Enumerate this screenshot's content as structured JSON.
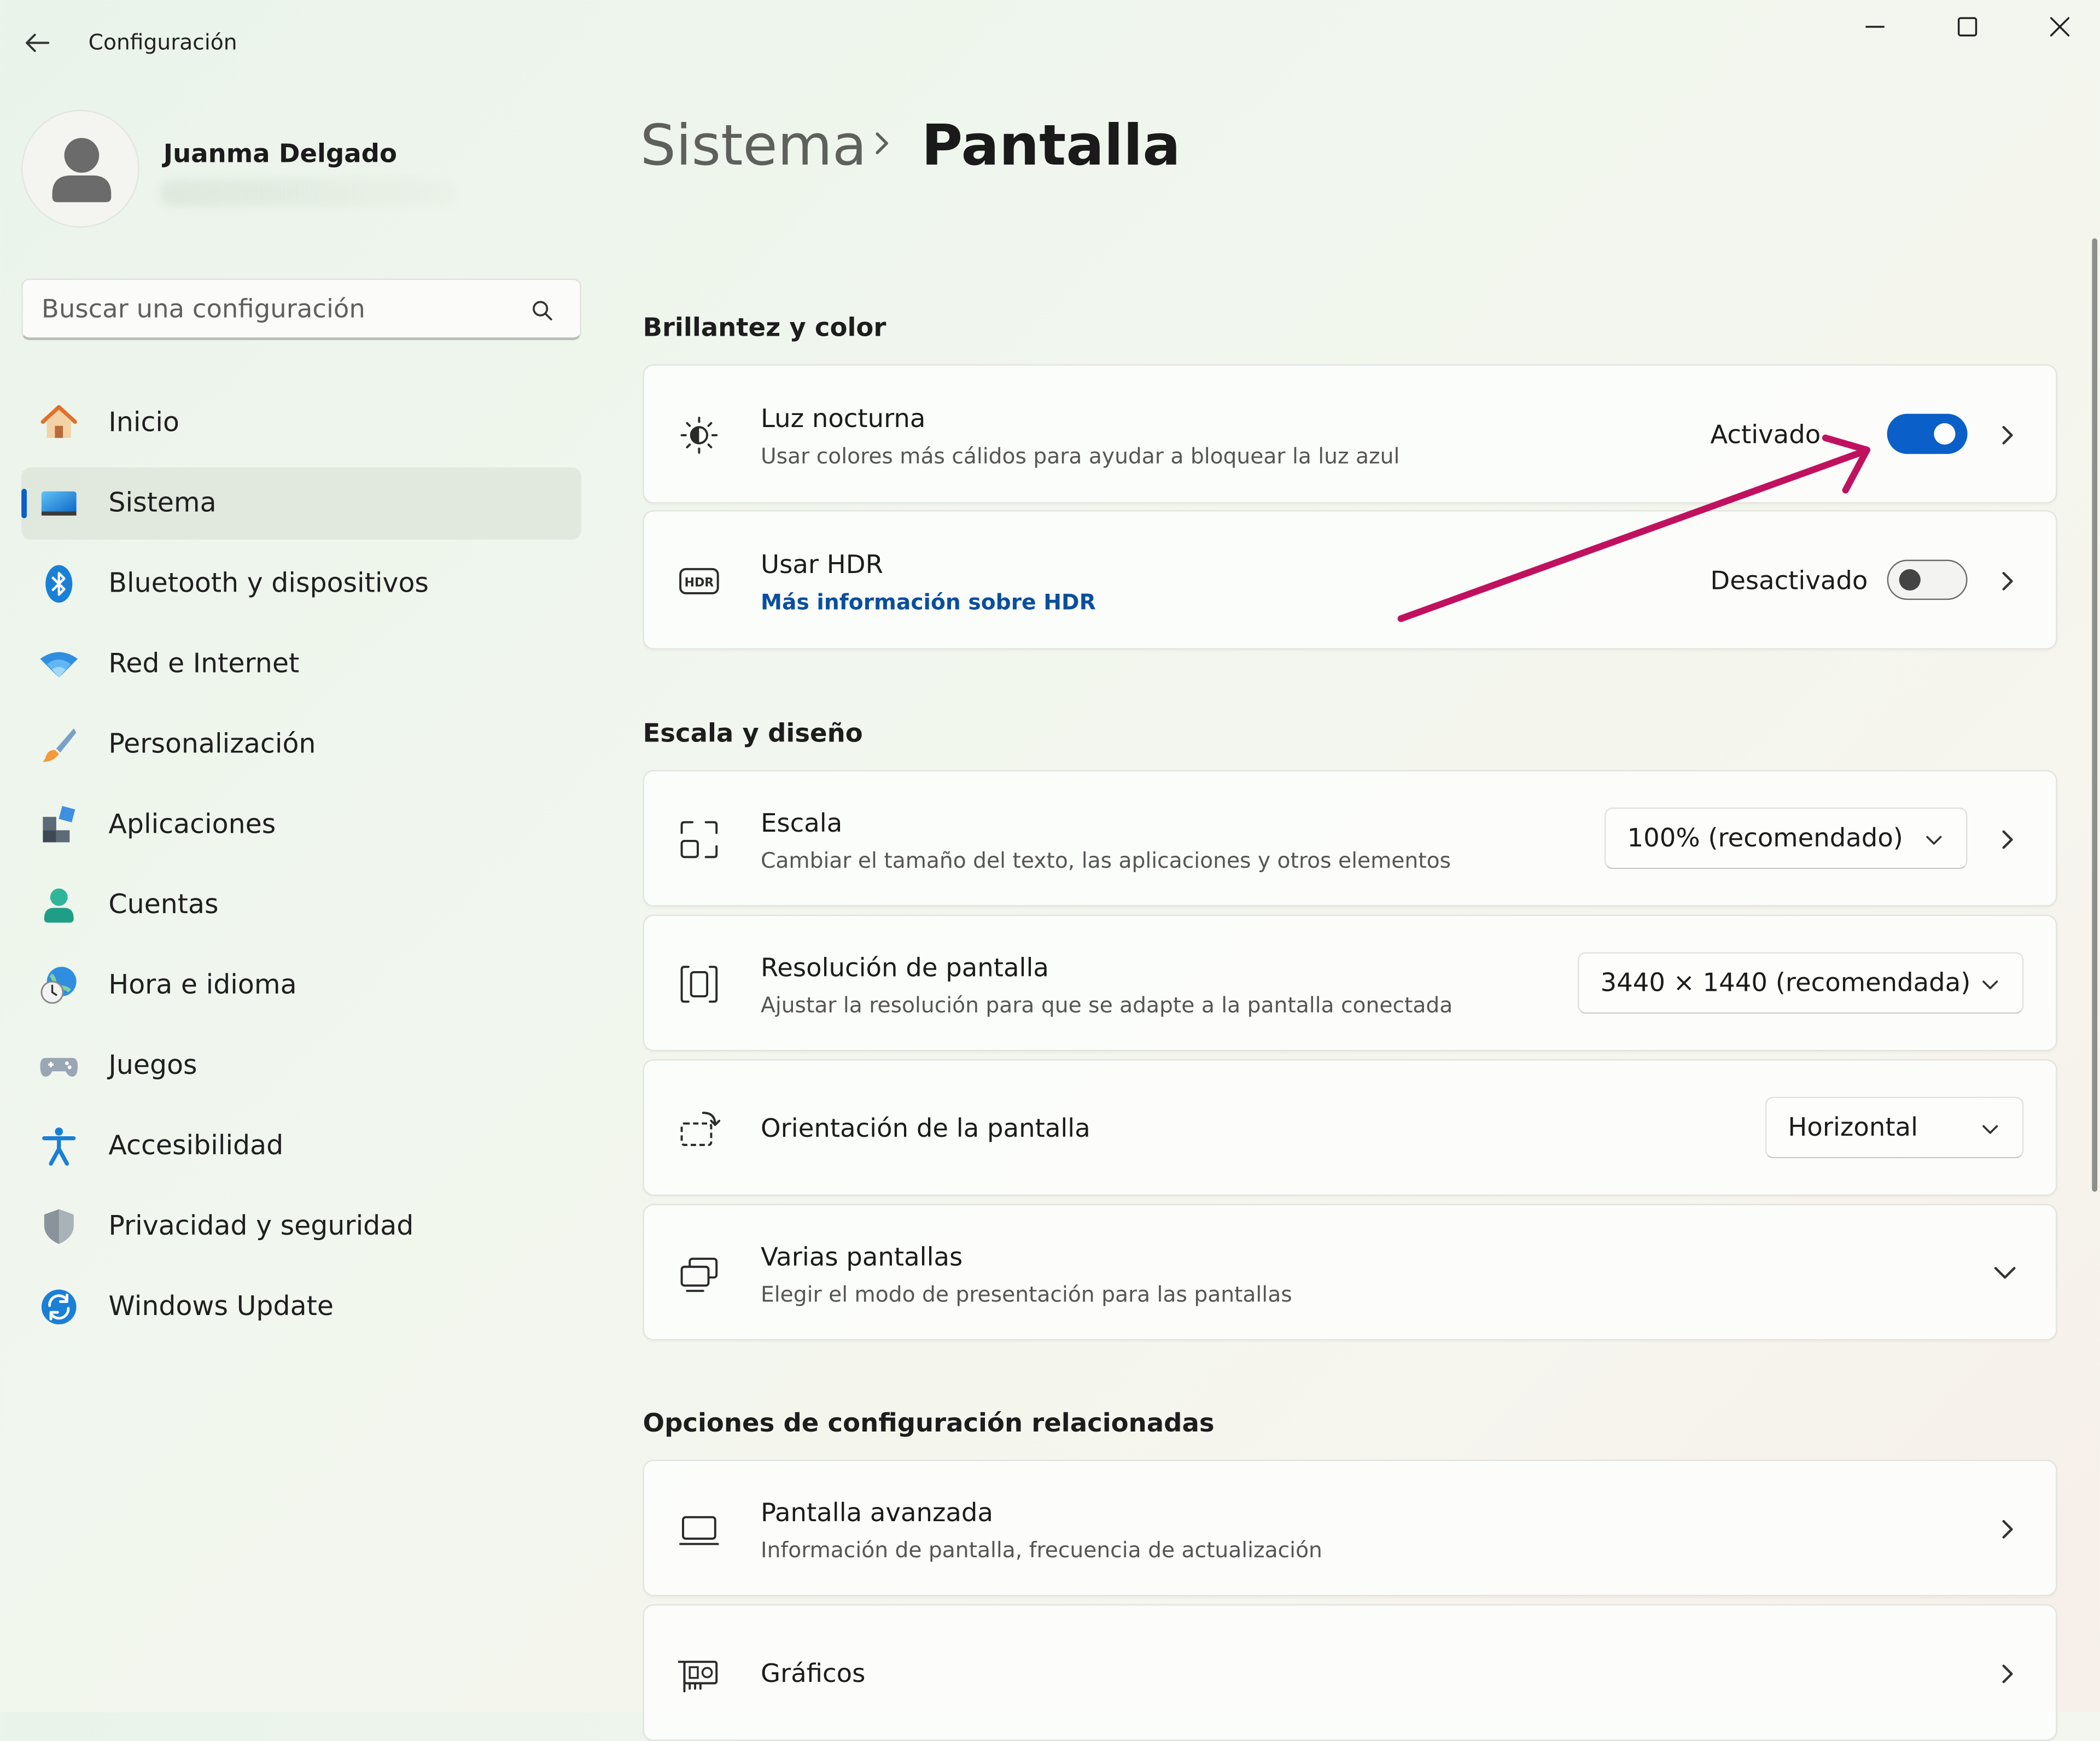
{
  "window": {
    "title": "Configuración"
  },
  "user": {
    "name": "Juanma Delgado"
  },
  "search": {
    "placeholder": "Buscar una configuración"
  },
  "nav": {
    "items": [
      {
        "label": "Inicio",
        "icon": "home-icon"
      },
      {
        "label": "Sistema",
        "icon": "system-icon",
        "active": true
      },
      {
        "label": "Bluetooth y dispositivos",
        "icon": "bluetooth-icon"
      },
      {
        "label": "Red e Internet",
        "icon": "wifi-icon"
      },
      {
        "label": "Personalización",
        "icon": "brush-icon"
      },
      {
        "label": "Aplicaciones",
        "icon": "apps-icon"
      },
      {
        "label": "Cuentas",
        "icon": "account-icon"
      },
      {
        "label": "Hora e idioma",
        "icon": "clock-globe-icon"
      },
      {
        "label": "Juegos",
        "icon": "gamepad-icon"
      },
      {
        "label": "Accesibilidad",
        "icon": "accessibility-icon"
      },
      {
        "label": "Privacidad y seguridad",
        "icon": "shield-icon"
      },
      {
        "label": "Windows Update",
        "icon": "update-icon"
      }
    ]
  },
  "header": {
    "parent": "Sistema",
    "current": "Pantalla"
  },
  "sections": {
    "brightness": {
      "title": "Brillantez y color",
      "night_light": {
        "title": "Luz nocturna",
        "subtitle": "Usar colores más cálidos para ayudar a bloquear la luz azul",
        "state": "Activado",
        "on": true
      },
      "hdr": {
        "title": "Usar HDR",
        "link": "Más información sobre HDR",
        "state": "Desactivado",
        "on": false
      }
    },
    "scale_layout": {
      "title": "Escala y diseño",
      "scale": {
        "title": "Escala",
        "subtitle": "Cambiar el tamaño del texto, las aplicaciones y otros elementos",
        "value": "100% (recomendado)"
      },
      "resolution": {
        "title": "Resolución de pantalla",
        "subtitle": "Ajustar la resolución para que se adapte a la pantalla conectada",
        "value": "3440 × 1440 (recomendada)"
      },
      "orientation": {
        "title": "Orientación de la pantalla",
        "value": "Horizontal"
      },
      "multiple": {
        "title": "Varias pantallas",
        "subtitle": "Elegir el modo de presentación para las pantallas"
      }
    },
    "related": {
      "title": "Opciones de configuración relacionadas",
      "advanced": {
        "title": "Pantalla avanzada",
        "subtitle": "Información de pantalla, frecuencia de actualización"
      },
      "graphics": {
        "title": "Gráficos"
      }
    }
  },
  "colors": {
    "accent": "#0a5fc8",
    "annotation_arrow": "#c0115f",
    "link": "#0a4f9e"
  }
}
